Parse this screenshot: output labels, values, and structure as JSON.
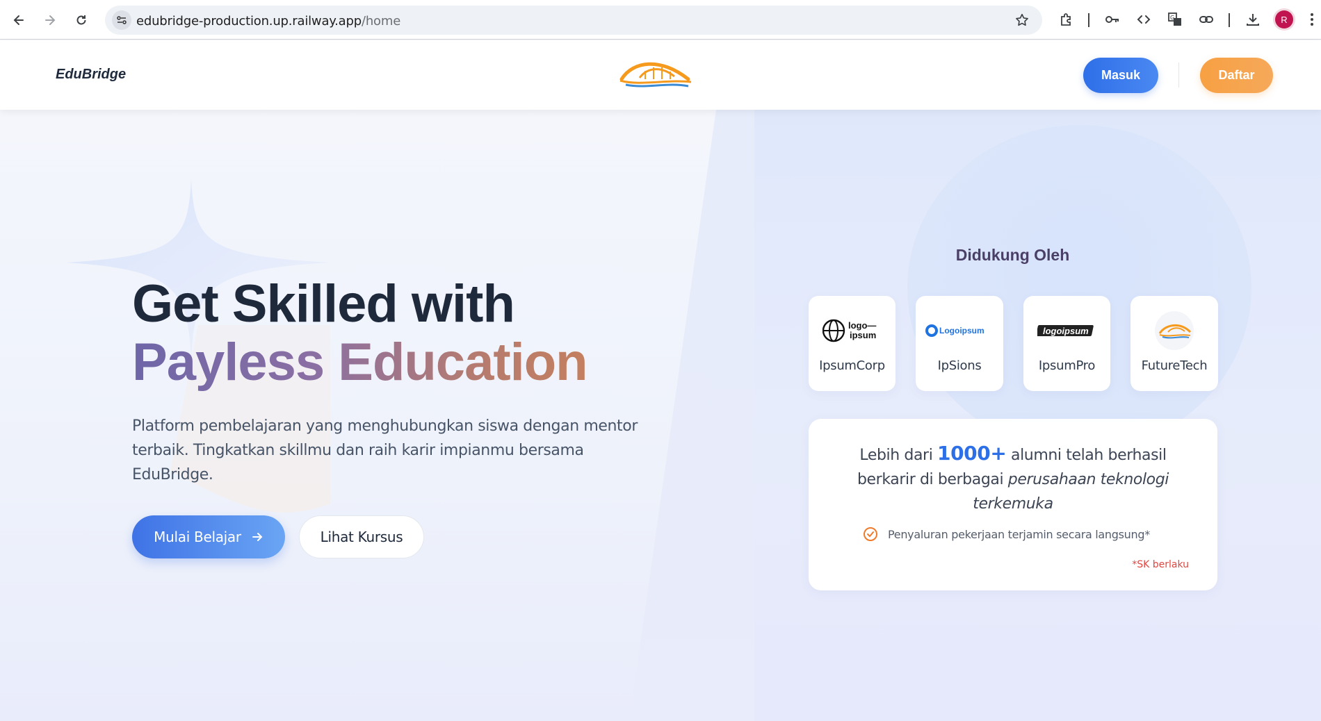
{
  "browser": {
    "url_host": "edubridge-production.up.railway.app",
    "url_path": "/home",
    "profile_initial": "R"
  },
  "header": {
    "brand": "EduBridge",
    "login_label": "Masuk",
    "register_label": "Daftar"
  },
  "hero": {
    "title_line1": "Get Skilled with",
    "title_line2": "Payless Education",
    "description": "Platform pembelajaran yang menghubungkan siswa dengan mentor terbaik. Tingkatkan skillmu dan raih karir impianmu bersama EduBridge.",
    "primary_cta": "Mulai Belajar",
    "secondary_cta": "Lihat Kursus"
  },
  "supported": {
    "title": "Didukung Oleh",
    "partners": [
      {
        "name": "IpsumCorp",
        "logo_text_1": "logo—",
        "logo_text_2": "ipsum"
      },
      {
        "name": "IpSions",
        "logo_text": "Logoipsum"
      },
      {
        "name": "IpsumPro",
        "logo_text": "logoipsum"
      },
      {
        "name": "FutureTech"
      }
    ]
  },
  "alumni": {
    "prefix": "Lebih dari ",
    "count": "1000+",
    "middle": " alumni telah berhasil berkarir di berbagai ",
    "emphasis": "perusahaan teknologi terkemuka",
    "guarantee": "Penyaluran pekerjaan terjamin secara langsung*",
    "terms": "*SK berlaku"
  },
  "colors": {
    "primary": "#2f6fe8",
    "accent_orange": "#f7a043",
    "heading": "#1e293b",
    "terms_red": "#e2463f"
  }
}
